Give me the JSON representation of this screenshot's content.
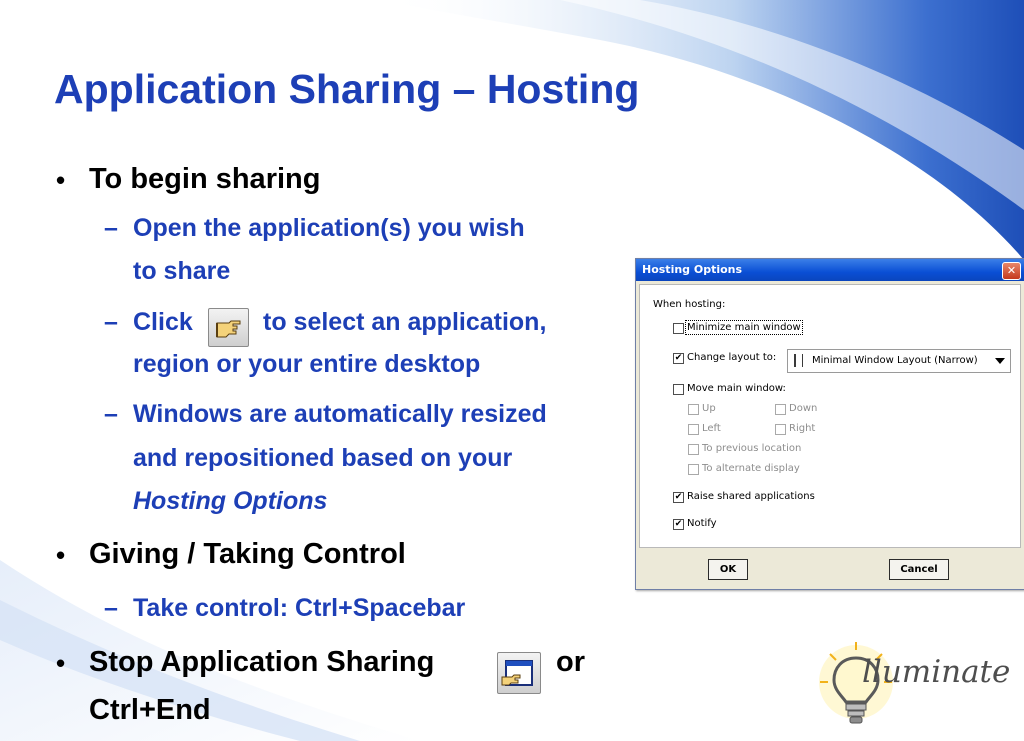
{
  "slide": {
    "title": "Application Sharing – Hosting",
    "bullets": {
      "b1": "To begin sharing",
      "b1_s1_l1": "Open the application(s) you wish",
      "b1_s1_l2": "to share",
      "b1_s2_a": "Click",
      "b1_s2_b": "to select an application,",
      "b1_s2_l2": "region or your entire desktop",
      "b1_s3_l1": "Windows are automatically resized",
      "b1_s3_l2": "and repositioned based on your",
      "b1_s3_l3": "Hosting Options",
      "b2": "Giving / Taking Control",
      "b2_s1": "Take control: Ctrl+Spacebar",
      "b3_a": "Stop Application Sharing",
      "b3_b": "or",
      "b3_l2": "Ctrl+End"
    },
    "bullet_char": "•",
    "dash_char": "–"
  },
  "dialog": {
    "title": "Hosting Options",
    "close_glyph": "✕",
    "section_label": "When hosting:",
    "options": {
      "minimize": {
        "label": "Minimize main window",
        "checked": false
      },
      "change_layout": {
        "label": "Change layout to:",
        "checked": true
      },
      "move": {
        "label": "Move main window:",
        "checked": false
      },
      "up": {
        "label": "Up",
        "checked": false
      },
      "down": {
        "label": "Down",
        "checked": false
      },
      "left": {
        "label": "Left",
        "checked": false
      },
      "right": {
        "label": "Right",
        "checked": false
      },
      "previous": {
        "label": "To previous location",
        "checked": false
      },
      "alternate": {
        "label": "To alternate display",
        "checked": false
      },
      "raise": {
        "label": "Raise shared applications",
        "checked": true
      },
      "notify": {
        "label": "Notify",
        "checked": true
      }
    },
    "check_glyph": "✔",
    "layout_select": {
      "value": "Minimal Window Layout (Narrow)"
    },
    "ok_label": "OK",
    "cancel_label": "Cancel"
  },
  "logo": {
    "text": "lluminate"
  },
  "colors": {
    "title": "#1d3fb6",
    "sub": "#1d3fb6",
    "text": "#000000",
    "dialog_title": "#0a4fd5"
  }
}
